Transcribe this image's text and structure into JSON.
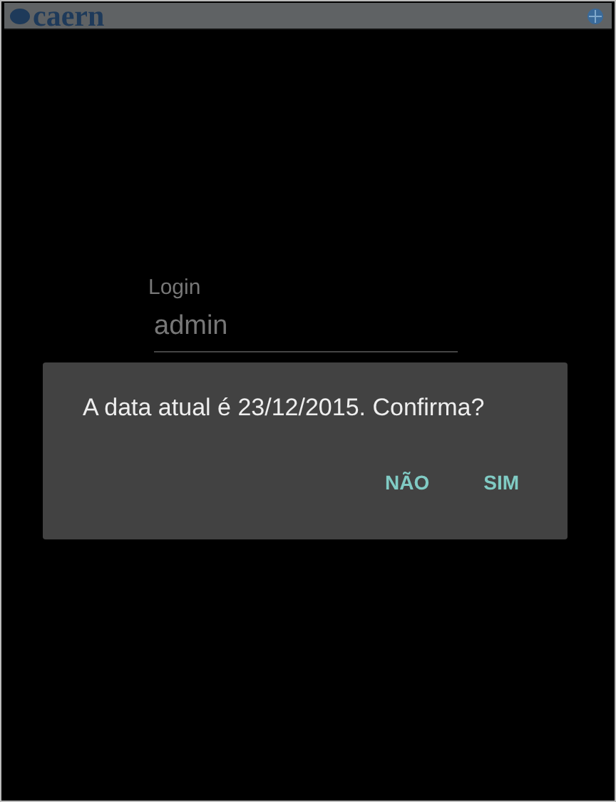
{
  "header": {
    "logo": "caern"
  },
  "login": {
    "label": "Login",
    "value": "admin"
  },
  "dialog": {
    "message": "A data atual é 23/12/2015. Confirma?",
    "buttons": [
      "NÃO",
      "SIM"
    ]
  }
}
